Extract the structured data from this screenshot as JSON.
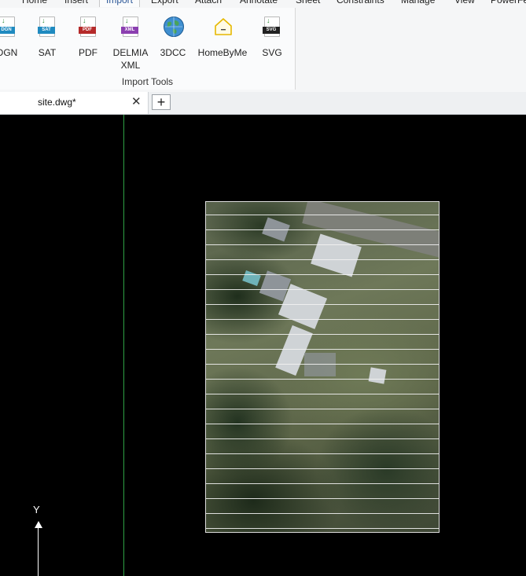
{
  "ribbon": {
    "tabs": [
      "Home",
      "Insert",
      "Import",
      "Export",
      "Attach",
      "Annotate",
      "Sheet",
      "Constraints",
      "Manage",
      "View",
      "PowerFe"
    ],
    "active_tab": "Import",
    "tools": [
      {
        "label": "DGN",
        "tag": "DGN",
        "color": "#1f8ac0"
      },
      {
        "label": "SAT",
        "tag": "SAT",
        "color": "#1f8ac0"
      },
      {
        "label": "PDF",
        "tag": "PDF",
        "color": "#b52a2a"
      },
      {
        "label": "DELMIA\nXML",
        "tag": "XML",
        "color": "#8b3fb0"
      },
      {
        "label": "3DCC",
        "tag": "",
        "color": "#2a7bc0"
      },
      {
        "label": "HomeByMe",
        "tag": "",
        "color": "#e6b800"
      },
      {
        "label": "SVG",
        "tag": "SVG",
        "color": "#222222"
      }
    ],
    "group_label": "Import Tools"
  },
  "doc_tabs": {
    "title": "site.dwg*",
    "close_glyph": "✕",
    "add_glyph": "+"
  },
  "canvas": {
    "axis_y_label": "Y",
    "background": "#000000",
    "guide_line_color": "#2ea043"
  }
}
